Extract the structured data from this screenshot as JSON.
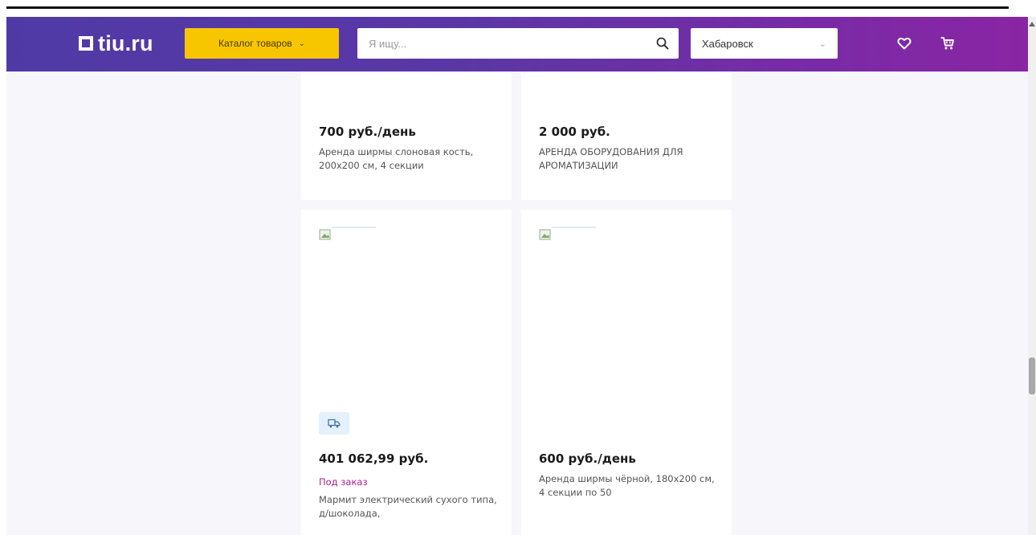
{
  "header": {
    "logo_text": "tiu.ru",
    "catalog_label": "Каталог товаров",
    "search_placeholder": "Я ищу...",
    "city": "Хабаровск"
  },
  "products": [
    {
      "price": "700 руб./день",
      "title": "Аренда ширмы слоновая кость, 200x200 см, 4 секции"
    },
    {
      "price": "2 000 руб.",
      "title": "АРЕНДА ОБОРУДОВАНИЯ ДЛЯ АРОМАТИЗАЦИИ"
    },
    {
      "price": "401 062,99 руб.",
      "order_status": "Под заказ",
      "title": "Мармит электрический сухого типа, д/шоколада,"
    },
    {
      "price": "600 руб./день",
      "title": "Аренда ширмы чёрной, 180x200 см, 4 секции по 50"
    }
  ],
  "colors": {
    "header_gradient_start": "#4f3aa5",
    "header_gradient_end": "#8a25a4",
    "catalog_button": "#f7c600",
    "order_status": "#b01899"
  }
}
